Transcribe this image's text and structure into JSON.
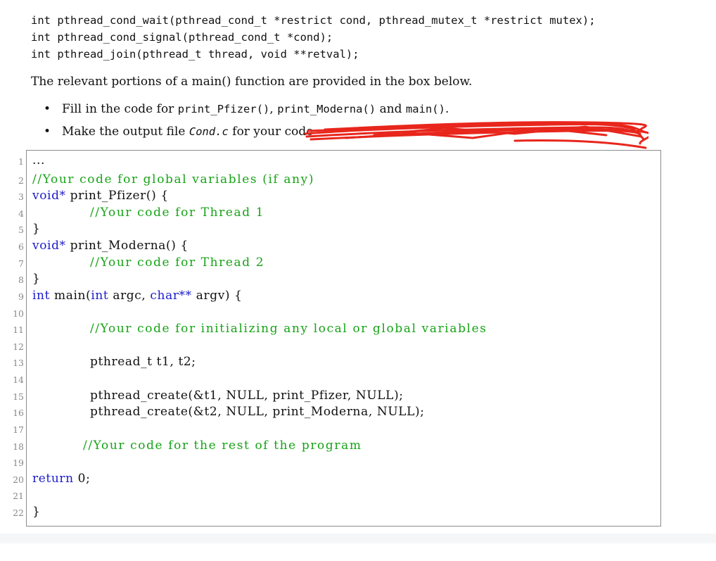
{
  "signatures": [
    "int pthread_cond_wait(pthread_cond_t *restrict cond, pthread_mutex_t *restrict mutex);",
    "int pthread_cond_signal(pthread_cond_t *cond);",
    "int pthread_join(pthread_t thread, void **retval);"
  ],
  "paragraph": "The relevant portions of a main() function are provided in the box below.",
  "bullet1": {
    "lead": "Fill in the code for ",
    "f1": "print_Pfizer()",
    "sep1": ", ",
    "f2": "print_Moderna()",
    "sep2": " and ",
    "f3": "main()",
    "tail": "."
  },
  "bullet2": {
    "lead": "Make the output file ",
    "file": "Cond.c",
    "tail": " for your code "
  },
  "listing": {
    "line_numbers": [
      "1",
      "2",
      "3",
      "4",
      "5",
      "6",
      "7",
      "8",
      "9",
      "10",
      "11",
      "12",
      "13",
      "14",
      "15",
      "16",
      "17",
      "18",
      "19",
      "20",
      "21",
      "22"
    ],
    "l1": "...",
    "l2": "//Your code for global variables (if any)",
    "l3_kw": "void*",
    "l3_rest": " print_Pfizer() {",
    "l4": "//Your code for Thread 1",
    "l5": "}",
    "l6_kw": "void*",
    "l6_rest": " print_Moderna() {",
    "l7": "//Your code for Thread 2",
    "l8": "}",
    "l9_kw1": "int",
    "l9_a": " main(",
    "l9_kw2": "int",
    "l9_b": " argc, ",
    "l9_kw3": "char**",
    "l9_c": " argv) {",
    "l11": "//Your code for initializing any local or global variables",
    "l13": "pthread_t t1, t2;",
    "l15": "pthread_create(&t1, NULL, print_Pfizer, NULL);",
    "l16": "pthread_create(&t2, NULL, print_Moderna, NULL);",
    "l18": "//Your code for the rest of the program",
    "l20_kw": "return",
    "l20_rest": " 0;",
    "l22": "}"
  },
  "colors": {
    "keyword": "#1c1cc9",
    "comment": "#17a317",
    "redaction": "#e8261c"
  }
}
